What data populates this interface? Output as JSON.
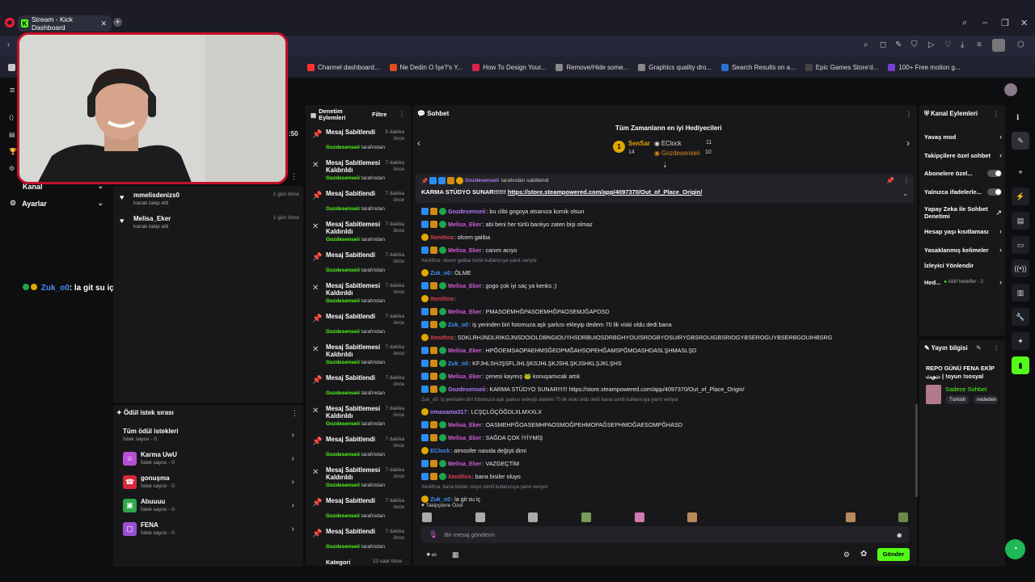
{
  "browser": {
    "tab_title": "Stream - Kick Dashboard",
    "bookmarks": [
      "Channel dashboard...",
      "Ne Dedin O İşe?'s Y...",
      "How To Design Your...",
      "Remove/Hide some...",
      "Graphics quality dro...",
      "Search Results on a...",
      "Epic Games Store'd...",
      "100+ Free motion g..."
    ]
  },
  "nav": {
    "channel_label": "Kanal",
    "settings_label": "Ayarlar",
    "overlay_user": "Zuk_o0",
    "overlay_text": ": la git su iç",
    "stray_time": ":50"
  },
  "activity": {
    "items": [
      {
        "name": "mmelisdenizs0",
        "sub": "kanalı takip etti",
        "time": "1 gün önce"
      },
      {
        "name": "Melisa_Eker",
        "sub": "kanalı takip etti",
        "time": "1 gün önce"
      }
    ]
  },
  "reward_queue": {
    "title": "Ödül istek sırası",
    "all_label": "Tüm ödül istekleri",
    "all_count": "İstek sayısı - 0",
    "items": [
      {
        "name": "Karma UwU",
        "count": "İstek sayısı - 0",
        "color": "#b84ed6"
      },
      {
        "name": "gonuşma",
        "count": "İstek sayısı - 0",
        "color": "#d8263a"
      },
      {
        "name": "Abuuuu",
        "count": "İstek sayısı - 0",
        "color": "#2ea84a"
      },
      {
        "name": "FENA",
        "count": "İstek sayısı - 0",
        "color": "#9b4fd6"
      }
    ]
  },
  "moderation": {
    "title": "Denetim Eylemleri",
    "filter_label": "Filtre",
    "by_user": "Gozdesenseii",
    "by_suffix": "tarafından",
    "rows": [
      {
        "title": "Mesaj Sabitlendi",
        "time": "5 dakika önce",
        "icon": "pin"
      },
      {
        "title": "Mesaj Sabitlemesi Kaldırıldı",
        "time": "7 dakika önce",
        "icon": "unpin"
      },
      {
        "title": "Mesaj Sabitlendi",
        "time": "7 dakika önce",
        "icon": "pin"
      },
      {
        "title": "Mesaj Sabitlemesi Kaldırıldı",
        "time": "7 dakika önce",
        "icon": "unpin"
      },
      {
        "title": "Mesaj Sabitlendi",
        "time": "7 dakika önce",
        "icon": "pin"
      },
      {
        "title": "Mesaj Sabitlemesi Kaldırıldı",
        "time": "7 dakika önce",
        "icon": "unpin"
      },
      {
        "title": "Mesaj Sabitlendi",
        "time": "7 dakika önce",
        "icon": "pin"
      },
      {
        "title": "Mesaj Sabitlemesi Kaldırıldı",
        "time": "7 dakika önce",
        "icon": "unpin"
      },
      {
        "title": "Mesaj Sabitlendi",
        "time": "7 dakika önce",
        "icon": "pin"
      },
      {
        "title": "Mesaj Sabitlemesi Kaldırıldı",
        "time": "7 dakika önce",
        "icon": "unpin"
      },
      {
        "title": "Mesaj Sabitlendi",
        "time": "7 dakika önce",
        "icon": "pin"
      },
      {
        "title": "Mesaj Sabitlemesi Kaldırıldı",
        "time": "7 dakika önce",
        "icon": "unpin"
      },
      {
        "title": "Mesaj Sabitlendi",
        "time": "7 dakika önce",
        "icon": "pin"
      },
      {
        "title": "Mesaj Sabitlendi",
        "time": "7 dakika önce",
        "icon": "pin"
      }
    ],
    "last_row": "Kategori",
    "last_time": "23 saat önce"
  },
  "chat": {
    "title": "Sohbet",
    "gifters_title": "Tüm Zamanların en iyi Hediyecileri",
    "gifters": [
      {
        "name": "SenSar",
        "count": "14"
      },
      {
        "name": "EClock",
        "count": "11"
      },
      {
        "name": "Gozdesenseii",
        "count": "10"
      }
    ],
    "pinned_by": "Gozdesenseii",
    "pinned_by_suffix": "tarafından sabitlendi",
    "pinned_text": "KARMA STÜDYO SUNAR!!!!!!",
    "pinned_link": "https://store.steampowered.com/app/4097370/Out_of_Place_Origin/",
    "messages": [
      {
        "user": "Gozdesenseii",
        "color": "#b27af5",
        "text": ": bu clibi gogoya atsanıza komik olsun"
      },
      {
        "user": "Melisa_Eker",
        "color": "#d15bd6",
        "text": ": abi beni her türlü banlıyo zaten bişi olmaz"
      },
      {
        "user": "Xenithra",
        "color": "#e0414e",
        "text": ": olcem galiba"
      },
      {
        "user": "Melisa_Eker",
        "color": "#d15bd6",
        "text": ": canım acıyo"
      },
      {
        "reply": "Xenithra: olcem galiba isimli kullanıcıya yanıt veriyor"
      },
      {
        "user": "Zuk_o0",
        "color": "#3f8ff7",
        "text": ": ÖLME"
      },
      {
        "user": "Melisa_Eker",
        "color": "#d15bd6",
        "text": ": gogo çok iyi saç ya kenks ;)"
      },
      {
        "user": "Xenithra",
        "color": "#e0414e",
        "text": ":"
      },
      {
        "user": "Melisa_Eker",
        "color": "#d15bd6",
        "text": ": PMASOEMHĞPASOEMHĞPAOSEMJĞAPOSD"
      },
      {
        "user": "Zuk_o0",
        "color": "#3f8ff7",
        "text": ": iş yerinden biri fotomuza aşk şarkısı ekleyip dedem 70 lik viski oldu dedi bana"
      },
      {
        "user": "Xenithra",
        "color": "#e0414e",
        "text": ": SDKLRHJNDLRIKGJNSDOIOLDBNGIOUYHSDRBUIOSDRBGHYOUISRDGBYOSUIRYGBSROUIGBSRIOGYBSEROGUYBSERBGOUIHBSRG"
      },
      {
        "user": "Melisa_Eker",
        "color": "#d15bd6",
        "text": ": HPĞOEMSAOPAEHMSĞEOPMĞAHSOPEHĞAMSPĞMOASHDASLŞHMASLŞD"
      },
      {
        "user": "Zuk_o0",
        "color": "#3f8ff7",
        "text": ": KFJHLSHJŞSFLJHLŞKSJHLŞKJSHLŞKJSHKLŞJKLŞHS"
      },
      {
        "user": "Melisa_Eker",
        "color": "#d15bd6",
        "text": ": çenesi kaymış 🐸 konuşamıcak artık"
      },
      {
        "user": "Gozdesenseii",
        "color": "#b27af5",
        "text": ": KARMA STÜDYO SUNAR!!!!!! https://store.steampowered.com/app/4097370/Out_of_Place_Origin/"
      },
      {
        "reply": "Zuk_o0: iş yerinden biri fotomuza aşk şarkısı ekleyip dedem 70 lik viski oldu dedi bana isimli kullanıcıya yanıt veriyor"
      },
      {
        "user": "irmaxama317",
        "color": "#b27af5",
        "text": ": LCŞÇLÖÇÖĞDLXLMXXLX"
      },
      {
        "user": "Melisa_Eker",
        "color": "#d15bd6",
        "text": ": OASMEHPĞOASEMHPAOSMOĞPEHMOPAĞSEPHMOĞAESOMPĞHASD"
      },
      {
        "user": "Melisa_Eker",
        "color": "#d15bd6",
        "text": ": SAĞDA ÇOK İYİYMİŞ"
      },
      {
        "user": "EClock",
        "color": "#3f8ff7",
        "text": ": atmosfer nasıda değişti dimi"
      },
      {
        "user": "Melisa_Eker",
        "color": "#d15bd6",
        "text": ": VAZGEÇTİM"
      },
      {
        "user": "Xenithra",
        "color": "#e0414e",
        "text": ": bana bisiler oluyo"
      },
      {
        "reply": "Xenithra: bana bisiler oluyo isimli kullanıcıya yanıt veriyor"
      },
      {
        "user": "Zuk_o0",
        "color": "#3f8ff7",
        "text": ": la git su iç"
      }
    ],
    "followers_only": "Takipçilere Özel",
    "input_placeholder": "Bir mesaj gönderin",
    "send_label": "Gönder"
  },
  "actions": {
    "title": "Kanal Eylemleri",
    "items": [
      {
        "label": "Yavaş mod",
        "type": "chev"
      },
      {
        "label": "Takipçilere özel sohbet",
        "type": "chev"
      },
      {
        "label": "Abonelere özel...",
        "type": "toggle"
      },
      {
        "label": "Yalnızca ifadelerle...",
        "type": "toggle"
      },
      {
        "label": "Yapay Zeka ile Sohbet Denetimi",
        "type": "ext"
      },
      {
        "label": "Hesap yaşı kısıtlaması",
        "type": "chev"
      },
      {
        "label": "Yasaklanmış kelimeler",
        "type": "chev"
      },
      {
        "label": "İzleyici Yönlendir",
        "type": "none"
      },
      {
        "label": "Hed...",
        "type": "chev"
      }
    ],
    "goal_status": "Aktif hedefler - 2"
  },
  "stream_info": {
    "title": "Yayın bilgisi",
    "stream_title": "REPO GÜNÜ FENA EKİP ت؈ت | !oyun !sosyal",
    "category": "Sadece Sohbet",
    "tags": [
      "Turkish",
      "nededen"
    ]
  },
  "colors": {
    "accent": "#53fc18",
    "panel": "#18181b",
    "bg": "#0e0e10"
  }
}
